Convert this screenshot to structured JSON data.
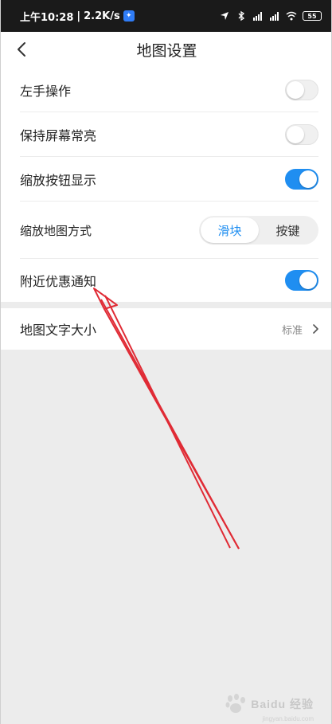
{
  "statusbar": {
    "time": "上午10:28",
    "speed": "2.2K/s",
    "battery": "55"
  },
  "header": {
    "title": "地图设置"
  },
  "settings": {
    "left_hand": {
      "label": "左手操作",
      "on": false
    },
    "screen_on": {
      "label": "保持屏幕常亮",
      "on": false
    },
    "zoom_buttons": {
      "label": "缩放按钮显示",
      "on": true
    },
    "zoom_mode": {
      "label": "缩放地图方式",
      "options": [
        "滑块",
        "按键"
      ],
      "selected": "滑块"
    },
    "nearby_deals": {
      "label": "附近优惠通知",
      "on": true
    },
    "map_text_size": {
      "label": "地图文字大小",
      "value": "标准"
    }
  },
  "colors": {
    "accent": "#1f8ef1",
    "annotation_arrow": "#e02b35"
  },
  "watermark": {
    "brand": "Baidu 经验",
    "url": "jingyan.baidu.com"
  }
}
